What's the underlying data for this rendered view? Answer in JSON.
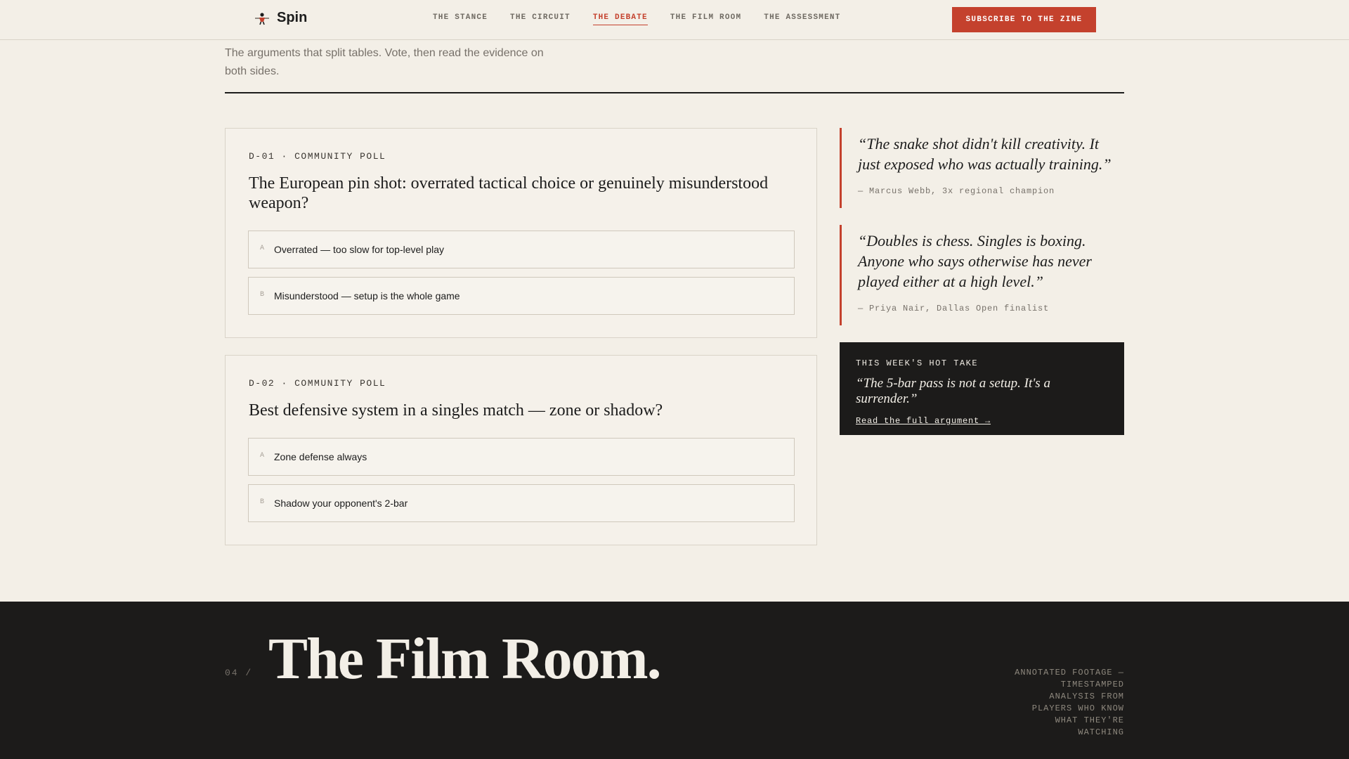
{
  "header": {
    "brand": "Spin",
    "nav": [
      {
        "label": "THE STANCE",
        "active": false
      },
      {
        "label": "THE CIRCUIT",
        "active": false
      },
      {
        "label": "THE DEBATE",
        "active": true
      },
      {
        "label": "THE FILM ROOM",
        "active": false
      },
      {
        "label": "THE ASSESSMENT",
        "active": false
      }
    ],
    "subscribe_label": "SUBSCRIBE TO THE ZINE"
  },
  "intro": "The arguments that split tables. Vote, then read the evidence on both sides.",
  "polls": [
    {
      "meta": "D-01 · COMMUNITY POLL",
      "question": "The European pin shot: overrated tactical choice or genuinely misunderstood weapon?",
      "options": [
        {
          "letter": "A",
          "text": "Overrated — too slow for top-level play"
        },
        {
          "letter": "B",
          "text": "Misunderstood — setup is the whole game"
        }
      ]
    },
    {
      "meta": "D-02 · COMMUNITY POLL",
      "question": "Best defensive system in a singles match — zone or shadow?",
      "options": [
        {
          "letter": "A",
          "text": "Zone defense always"
        },
        {
          "letter": "B",
          "text": "Shadow your opponent's 2-bar"
        }
      ]
    }
  ],
  "quotes": [
    {
      "text": "“The snake shot didn't kill creativity. It just exposed who was actually training.”",
      "attribution": "— Marcus Webb, 3x regional champion"
    },
    {
      "text": "“Doubles is chess. Singles is boxing. Anyone who says otherwise has never played either at a high level.”",
      "attribution": "— Priya Nair, Dallas Open finalist"
    }
  ],
  "hottake": {
    "label": "THIS WEEK'S HOT TAKE",
    "text": "“The 5-bar pass is not a setup. It's a surrender.”",
    "link": "Read the full argument →"
  },
  "film": {
    "number": "04 /",
    "title": "The Film Room.",
    "description": "ANNOTATED FOOTAGE — TIMESTAMPED ANALYSIS FROM PLAYERS WHO KNOW WHAT THEY'RE WATCHING"
  },
  "colors": {
    "accent": "#c4412d",
    "background": "#f3efe7",
    "dark": "#1c1b1a"
  }
}
